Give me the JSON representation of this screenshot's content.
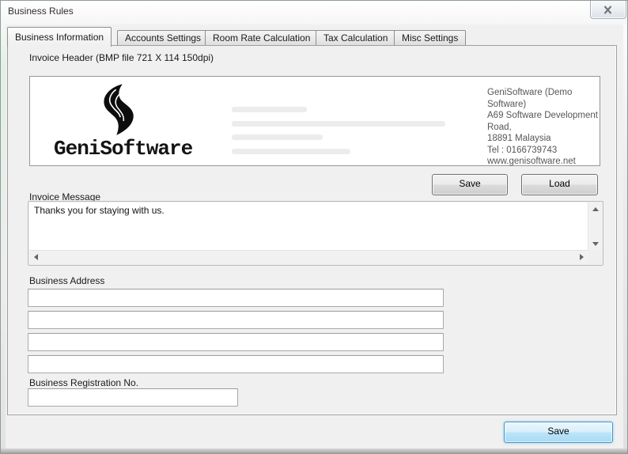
{
  "window": {
    "title": "Business Rules"
  },
  "tabs": [
    {
      "label": "Business Information",
      "active": true
    },
    {
      "label": "Accounts Settings",
      "active": false
    },
    {
      "label": "Room Rate Calculation",
      "active": false
    },
    {
      "label": "Tax Calculation",
      "active": false
    },
    {
      "label": "Misc Settings",
      "active": false
    }
  ],
  "invoice_header": {
    "label": "Invoice Header (BMP file 721 X 114 150dpi)",
    "logo_text": "GeniSoftware",
    "company_info": {
      "line1": "GeniSoftware (Demo Software)",
      "line2": "A69 Software Development Road,",
      "line3": "18891 Malaysia",
      "line4": "Tel : 0166739743",
      "line5": "www.genisoftware.net"
    },
    "save_button": "Save",
    "load_button": "Load"
  },
  "invoice_message": {
    "label": "Invoice Message",
    "value": "Thanks you for staying with us."
  },
  "business_address": {
    "label": "Business Address",
    "line1": "",
    "line2": "",
    "line3": "",
    "line4": ""
  },
  "business_registration": {
    "label": "Business Registration No.",
    "value": ""
  },
  "footer": {
    "save_button": "Save"
  },
  "colors": {
    "dialog_background": "#f0f0f0",
    "default_button_fill": "#bde5f9",
    "default_button_border": "#4496c8",
    "logo_color": "#141414",
    "company_info_text": "#565656"
  }
}
